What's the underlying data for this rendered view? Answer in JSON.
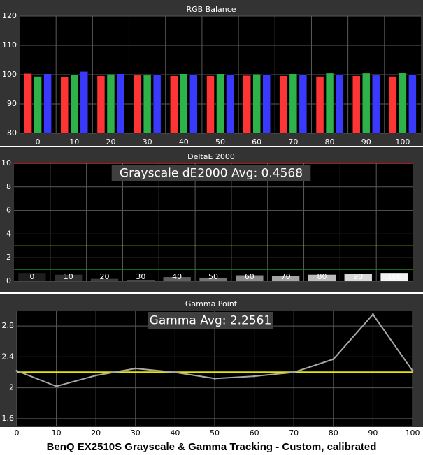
{
  "caption": "BenQ EX2510S Grayscale & Gamma Tracking - Custom, calibrated",
  "colors": {
    "background": "#333333",
    "plot_background": "#000000",
    "grid": "#5a5a5a",
    "text": "#ffffff",
    "red": "#ff3535",
    "green": "#2db34a",
    "blue": "#3a3aff",
    "reference_red": "#ff3030",
    "reference_yellow": "#d8d820",
    "reference_green": "#1a8a1a",
    "gamma_line": "#a8a8a8",
    "gamma_target": "#e6e600",
    "banner_bg": "#3f3f3f"
  },
  "chart_data": [
    {
      "type": "bar",
      "title": "RGB Balance",
      "categories": [
        "0",
        "10",
        "20",
        "30",
        "40",
        "50",
        "60",
        "70",
        "80",
        "90",
        "100"
      ],
      "series": [
        {
          "color": "red",
          "values": [
            100.4,
            99.1,
            99.6,
            99.8,
            99.6,
            99.6,
            99.7,
            99.6,
            99.4,
            99.6,
            99.4
          ]
        },
        {
          "color": "green",
          "values": [
            99.4,
            100.1,
            100.2,
            99.8,
            100.3,
            100.3,
            100.2,
            100.3,
            100.5,
            100.5,
            100.6
          ]
        },
        {
          "color": "blue",
          "values": [
            100.3,
            101.1,
            100.3,
            100.1,
            100.0,
            100.1,
            100.1,
            100.0,
            100.0,
            99.8,
            100.1
          ]
        }
      ],
      "ylim": [
        80,
        120
      ],
      "yticks": [
        80,
        90,
        100,
        110,
        120
      ],
      "grid": true
    },
    {
      "type": "bar",
      "title": "DeltaE 2000",
      "annotation": "Grayscale dE2000 Avg: 0.4568",
      "categories": [
        "0",
        "10",
        "20",
        "30",
        "40",
        "50",
        "60",
        "70",
        "80",
        "90",
        "100"
      ],
      "values": [
        0.7,
        0.55,
        0.2,
        0.12,
        0.35,
        0.3,
        0.5,
        0.45,
        0.55,
        0.6,
        0.7
      ],
      "bar_shades": [
        "#1e1e1e",
        "#303030",
        "#3c3c3c",
        "#484848",
        "#5e5e5e",
        "#747474",
        "#8c8c8c",
        "#a4a4a4",
        "#bcbcbc",
        "#d8d8d8",
        "#f4f4f4"
      ],
      "reference_lines": [
        {
          "value": 10,
          "color": "reference_red"
        },
        {
          "value": 3,
          "color": "reference_yellow"
        },
        {
          "value": 1,
          "color": "reference_green"
        }
      ],
      "ylim": [
        0,
        10
      ],
      "yticks": [
        0,
        2,
        4,
        6,
        8,
        10
      ],
      "grid": true
    },
    {
      "type": "line",
      "title": "Gamma Point",
      "annotation": "Gamma Avg: 2.2561",
      "x": [
        0,
        10,
        20,
        30,
        40,
        50,
        60,
        70,
        80,
        90,
        100
      ],
      "values": [
        2.22,
        2.02,
        2.16,
        2.25,
        2.2,
        2.12,
        2.15,
        2.2,
        2.37,
        2.95,
        2.22
      ],
      "target": 2.2,
      "ylim": [
        1.5,
        3.0
      ],
      "yticks": [
        1.6,
        2,
        2.4,
        2.8
      ],
      "xticks": [
        0,
        10,
        20,
        30,
        40,
        50,
        60,
        70,
        80,
        90,
        100
      ],
      "grid": true
    }
  ]
}
